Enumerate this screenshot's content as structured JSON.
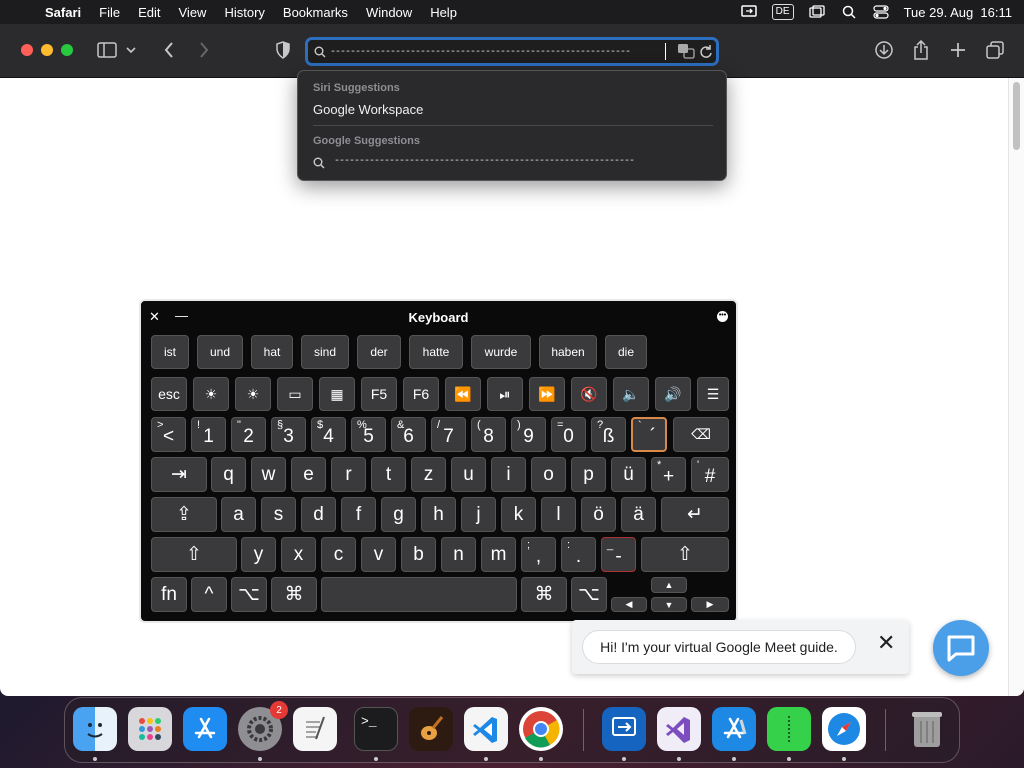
{
  "menubar": {
    "app_name": "Safari",
    "items": [
      "File",
      "Edit",
      "View",
      "History",
      "Bookmarks",
      "Window",
      "Help"
    ],
    "input_source": "DE",
    "datetime": "Tue 29. Aug  16:11"
  },
  "address_bar": {
    "value": "------------------------------------------------------------"
  },
  "suggestions": {
    "section1": "Siri Suggestions",
    "item1": "Google Workspace",
    "section2": "Google Suggestions",
    "item2": "------------------------------------------------------------"
  },
  "keyboard": {
    "title": "Keyboard",
    "predictions": [
      "ist",
      "und",
      "hat",
      "sind",
      "der",
      "hatte",
      "wurde",
      "haben",
      "die"
    ],
    "fn_row": [
      "esc",
      "☀",
      "☀",
      "▭",
      "▦",
      "F5",
      "F6",
      "⏪",
      "⏯",
      "⏩",
      "🔇",
      "🔈",
      "🔊",
      "☰"
    ],
    "row_numbers": [
      {
        "alt": ">",
        "main": "<"
      },
      {
        "alt": "!",
        "main": "1"
      },
      {
        "alt": "\"",
        "main": "2"
      },
      {
        "alt": "§",
        "main": "3"
      },
      {
        "alt": "$",
        "main": "4"
      },
      {
        "alt": "%",
        "main": "5"
      },
      {
        "alt": "&",
        "main": "6"
      },
      {
        "alt": "/",
        "main": "7"
      },
      {
        "alt": "(",
        "main": "8"
      },
      {
        "alt": ")",
        "main": "9"
      },
      {
        "alt": "=",
        "main": "0"
      },
      {
        "alt": "?",
        "main": "ß"
      },
      {
        "alt": "`",
        "main": "´"
      }
    ],
    "row_q": [
      "q",
      "w",
      "e",
      "r",
      "t",
      "z",
      "u",
      "i",
      "o",
      "p",
      "ü"
    ],
    "row_q_extra": [
      {
        "alt": "*",
        "main": "+"
      },
      {
        "alt": "'",
        "main": "#"
      }
    ],
    "row_a": [
      "a",
      "s",
      "d",
      "f",
      "g",
      "h",
      "j",
      "k",
      "l",
      "ö",
      "ä"
    ],
    "row_y": [
      "y",
      "x",
      "c",
      "v",
      "b",
      "n",
      "m"
    ],
    "row_y_extra": [
      {
        "alt": ";",
        "main": ","
      },
      {
        "alt": ":",
        "main": "."
      },
      {
        "alt": "_",
        "main": "-"
      }
    ],
    "tab": "⇥",
    "shift": "⇧",
    "capslock": "⇪",
    "return": "↵",
    "delete": "⌫",
    "fn": "fn",
    "control": "^",
    "option": "⌥",
    "command": "⌘",
    "arrows": {
      "up": "▲",
      "left": "◀",
      "down": "▼",
      "right": "▶"
    }
  },
  "meet_guide": {
    "message": "Hi! I'm your virtual Google Meet guide.",
    "close": "✕"
  },
  "dock": {
    "settings_badge": "2",
    "terminal_label": ">_"
  }
}
